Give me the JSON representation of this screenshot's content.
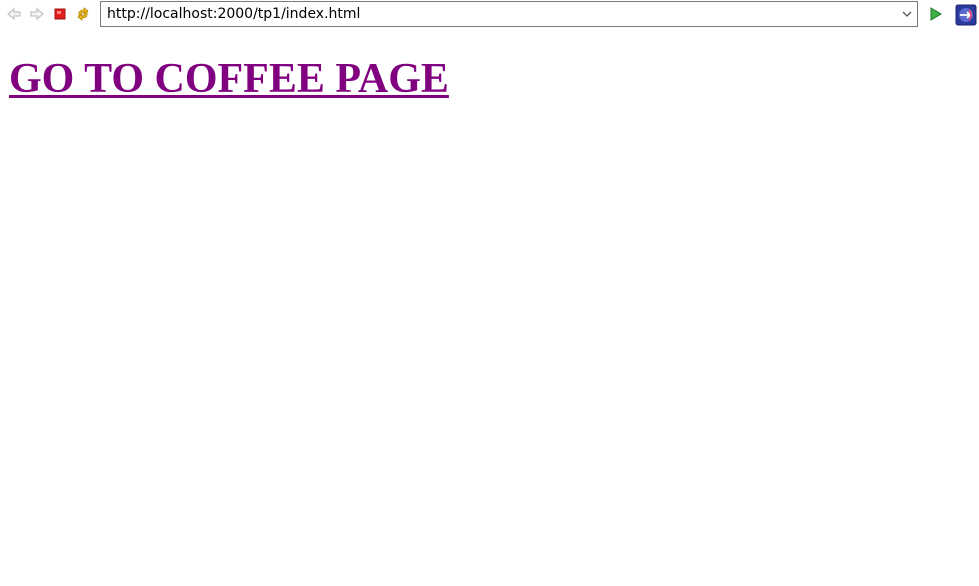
{
  "toolbar": {
    "address": "http://localhost:2000/tp1/index.html",
    "icons": {
      "back": "arrow-left-icon",
      "forward": "arrow-right-icon",
      "stop": "stop-icon",
      "refresh": "refresh-icon",
      "dropdown": "chevron-down-icon",
      "go": "play-icon",
      "app": "app-logo-icon"
    }
  },
  "page": {
    "link_text": "GO TO COFFEE PAGE",
    "link_color": "#800080"
  }
}
